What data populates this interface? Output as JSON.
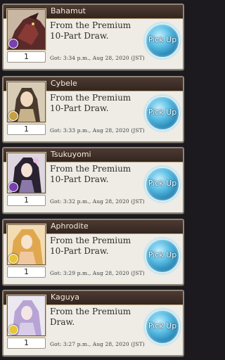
{
  "items": [
    {
      "name": "Bahamut",
      "description": "From the Premium 10-Part Draw.",
      "count": "1",
      "got": "Got: 3:34 p.m., Aug 28, 2020 (JST)",
      "button": "Pick Up",
      "element_color": "#7a3fb0",
      "portrait": "dark-dragon"
    },
    {
      "name": "Cybele",
      "description": "From the Premium 10-Part Draw.",
      "count": "1",
      "got": "Got: 3:33 p.m., Aug 28, 2020 (JST)",
      "button": "Pick Up",
      "element_color": "#c9a040",
      "portrait": "earth-goddess"
    },
    {
      "name": "Tsukuyomi",
      "description": "From the Premium 10-Part Draw.",
      "count": "1",
      "got": "Got: 3:32 p.m., Aug 28, 2020 (JST)",
      "button": "Pick Up",
      "element_color": "#7a3fb0",
      "portrait": "moon-maiden"
    },
    {
      "name": "Aphrodite",
      "description": "From the Premium 10-Part Draw.",
      "count": "1",
      "got": "Got: 3:29 p.m., Aug 28, 2020 (JST)",
      "button": "Pick Up",
      "element_color": "#e6c53a",
      "portrait": "light-goddess"
    },
    {
      "name": "Kaguya",
      "description": "From the Premium Draw.",
      "count": "1",
      "got": "Got: 3:27 p.m., Aug 28, 2020 (JST)",
      "button": "Pick Up",
      "element_color": "#e6c53a",
      "portrait": "princess"
    }
  ]
}
